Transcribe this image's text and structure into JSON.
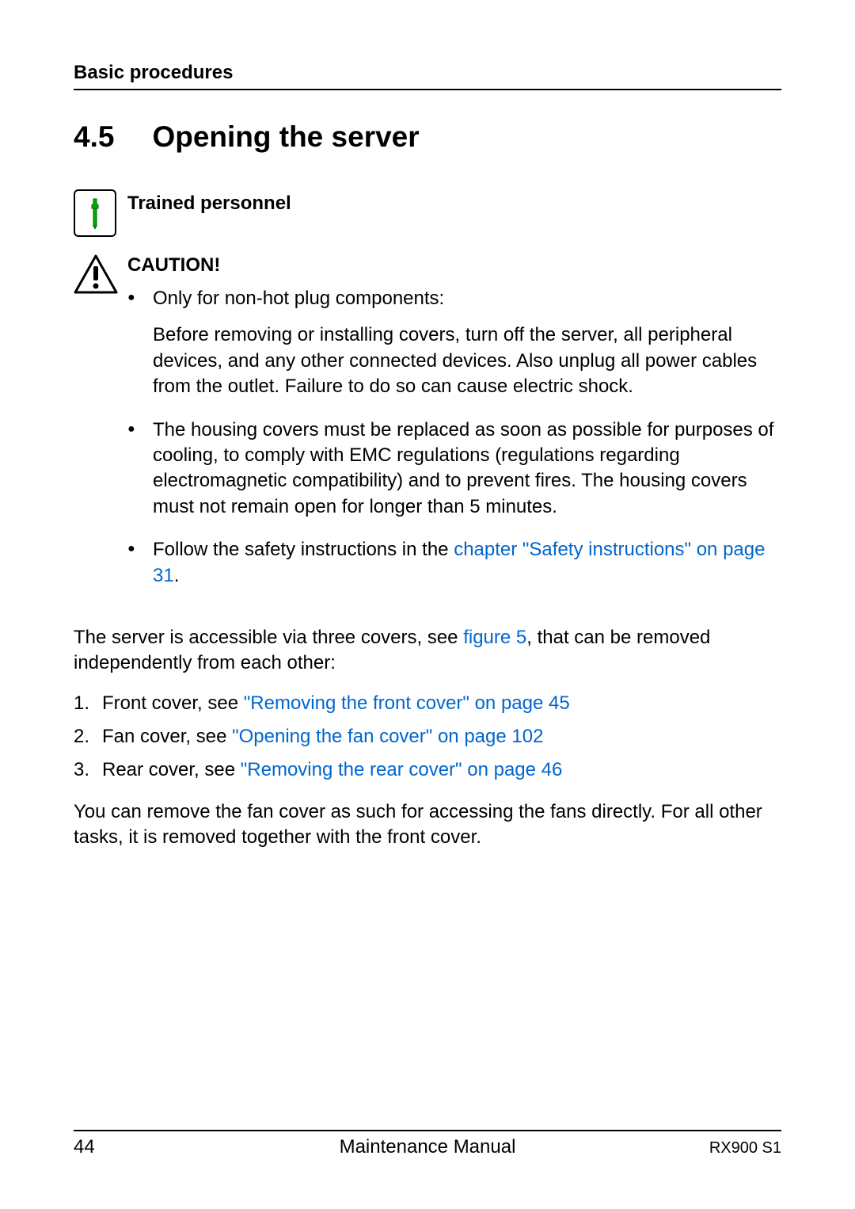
{
  "header": {
    "title": "Basic procedures"
  },
  "section": {
    "number": "4.5",
    "title": "Opening the server"
  },
  "trained": {
    "label": "Trained personnel"
  },
  "caution": {
    "label": "CAUTION!",
    "bullets": [
      {
        "text": "Only for non-hot plug components:",
        "sub": "Before removing or installing covers, turn off the server, all peripheral devices, and any other connected devices. Also unplug all power cables from the outlet. Failure to do so can cause electric shock."
      },
      {
        "text": "The housing covers must be replaced as soon as possible for purposes of cooling, to comply with EMC regulations (regulations regarding electromagnetic compatibility) and to prevent fires. The housing covers must not remain open for longer than 5 minutes."
      },
      {
        "text_pre": "Follow the safety instructions in the ",
        "link": "chapter \"Safety instructions\" on page 31",
        "text_post": "."
      }
    ]
  },
  "body": {
    "intro_pre": "The server is accessible via three covers, see ",
    "intro_link": "figure 5",
    "intro_post": ", that can be removed independently from each other:",
    "covers": [
      {
        "pre": "Front cover, see ",
        "link": "\"Removing the front cover\" on page 45"
      },
      {
        "pre": "Fan cover, see ",
        "link": "\"Opening the fan cover\" on page 102"
      },
      {
        "pre": "Rear cover, see ",
        "link": "\"Removing the rear cover\" on page 46"
      }
    ],
    "outro": "You can remove the fan cover as such for accessing the fans directly. For all other tasks, it is removed together with the front cover."
  },
  "footer": {
    "page": "44",
    "center": "Maintenance Manual",
    "right": "RX900 S1"
  }
}
